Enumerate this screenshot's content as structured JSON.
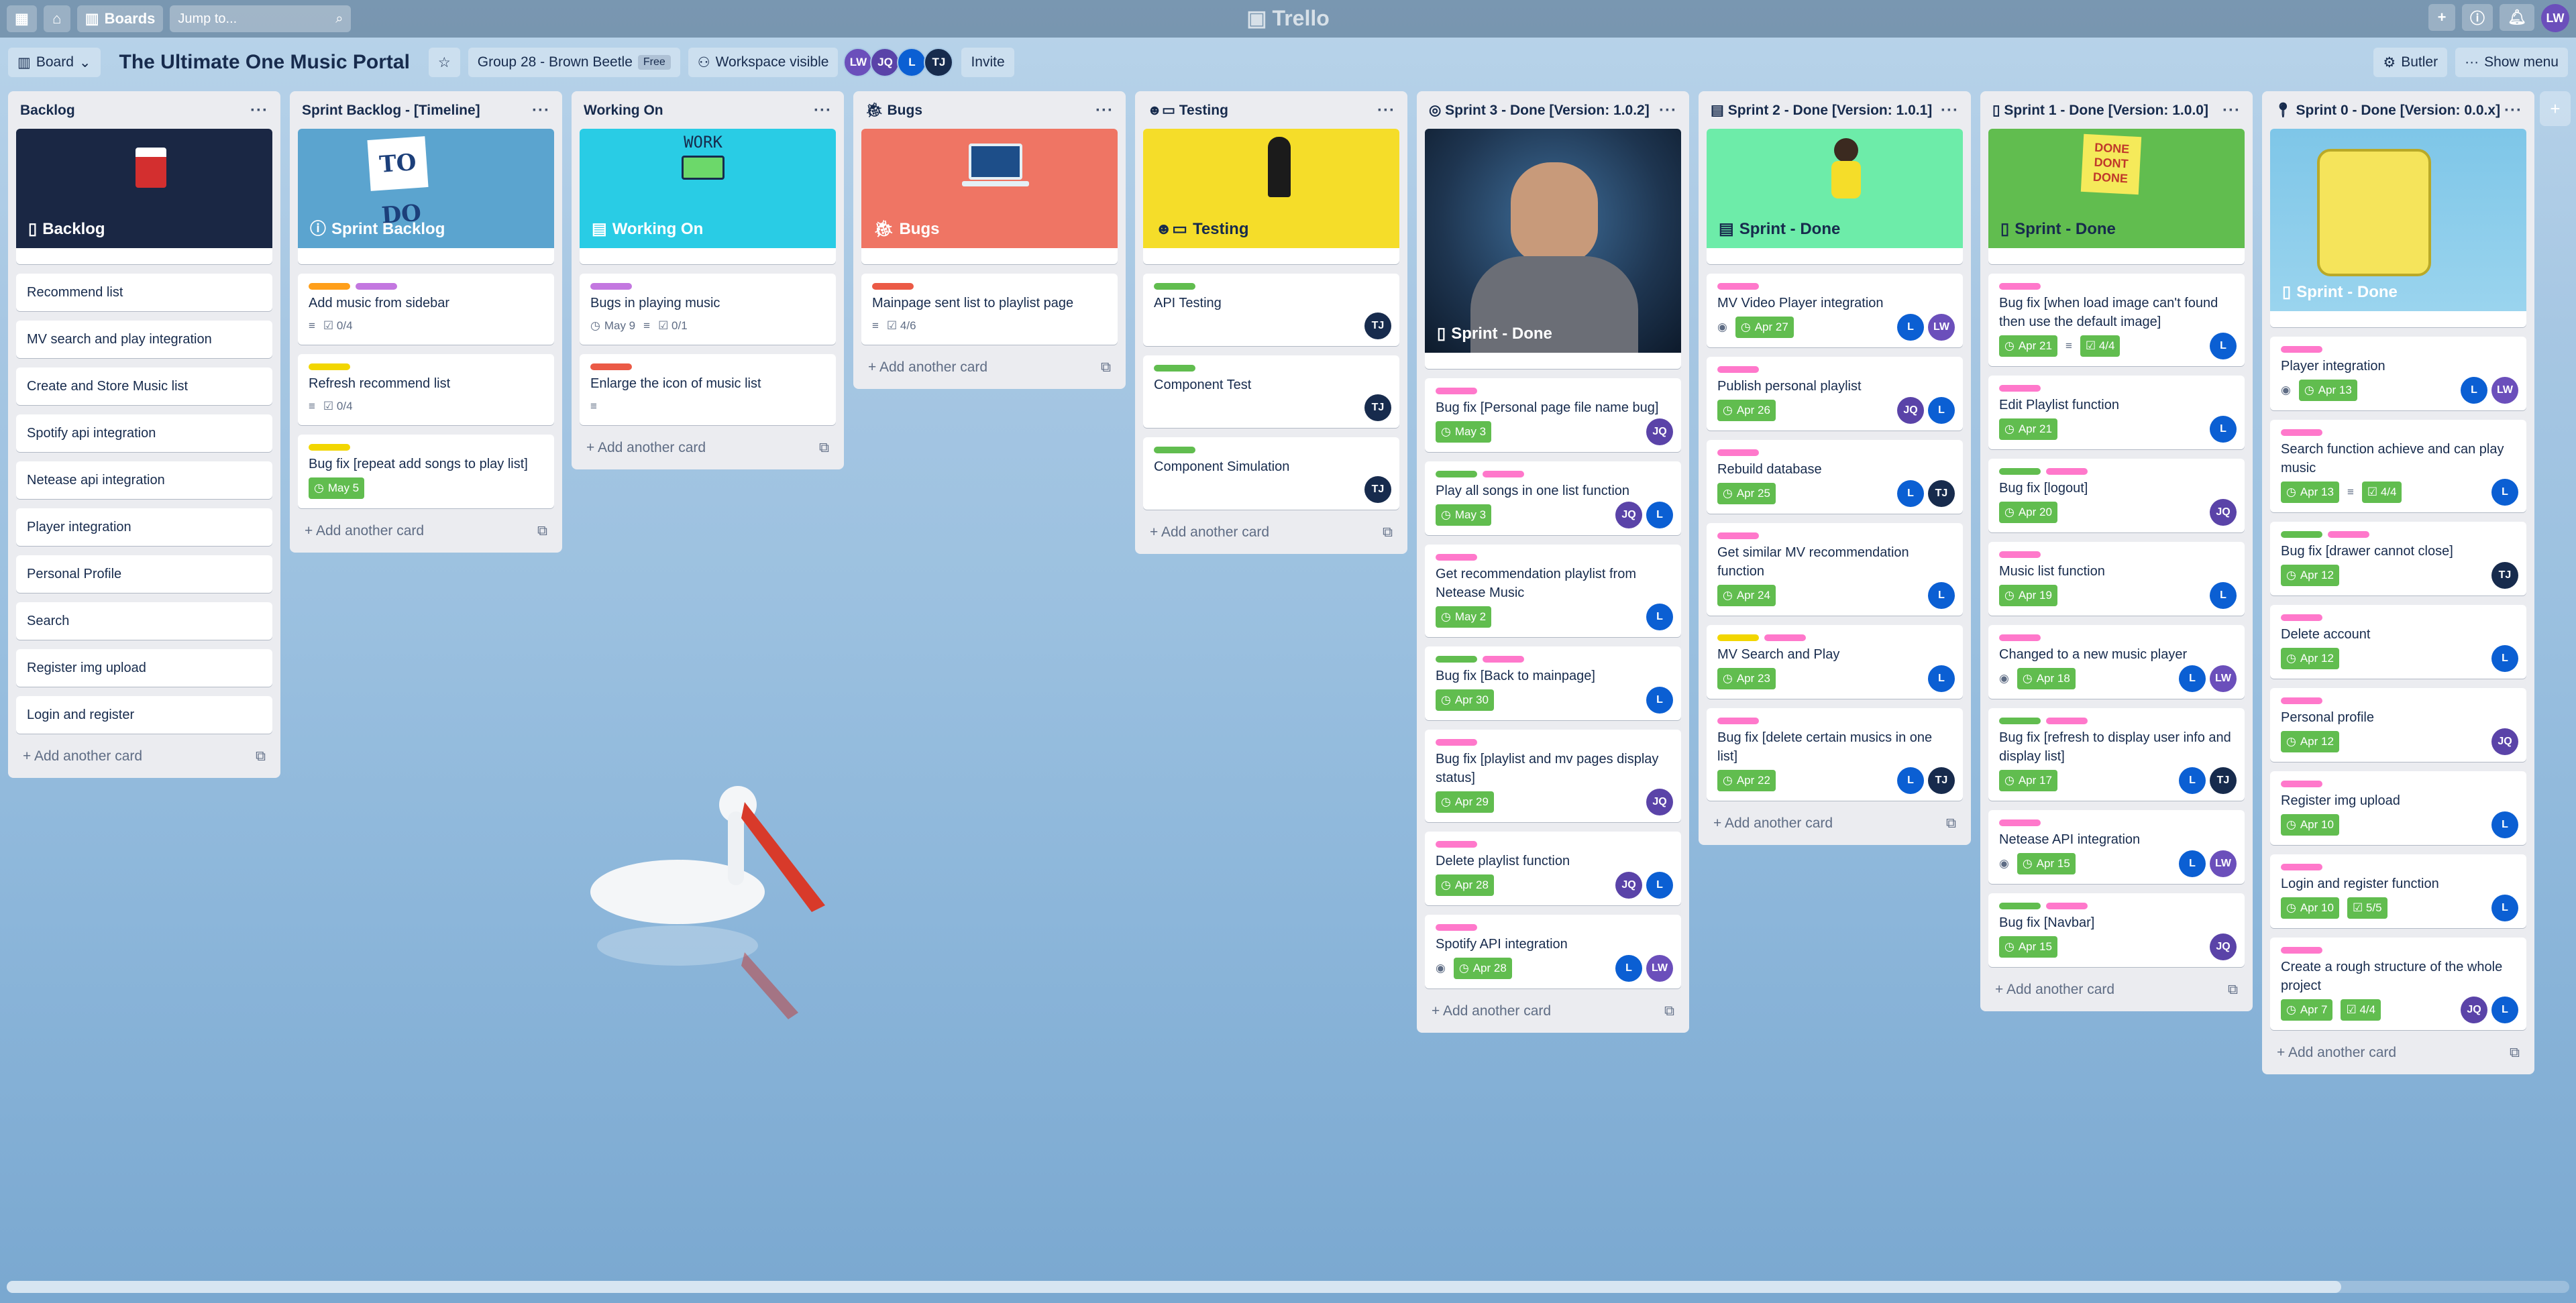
{
  "topbar": {
    "boards_label": "Boards",
    "search_placeholder": "Jump to...",
    "logo_text": "Trello",
    "user_initials": "LW"
  },
  "board": {
    "board_menu_label": "Board",
    "title": "The Ultimate One Music Portal",
    "team_label": "Group 28 - Brown Beetle",
    "team_plan": "Free",
    "visibility_label": "Workspace visible",
    "members": [
      "LW",
      "JQ",
      "L",
      "TJ"
    ],
    "invite_label": "Invite",
    "butler_label": "Butler",
    "show_menu_label": "Show menu"
  },
  "add_card_label": "+ Add another card",
  "lists": [
    {
      "title": "Backlog",
      "cover_title": "Backlog",
      "cards": [
        "Recommend list",
        "MV search and play integration",
        "Create and Store Music list",
        "Spotify api integration",
        "Netease api integration",
        "Player integration",
        "Personal Profile",
        "Search",
        "Register img upload",
        "Login and register"
      ]
    },
    {
      "title": "Sprint Backlog - [Timeline]",
      "cover_title": "Sprint Backlog",
      "cards": [
        {
          "title": "Add music from sidebar",
          "check": "0/4"
        },
        {
          "title": "Refresh recommend list",
          "check": "0/4"
        },
        {
          "title": "Bug fix [repeat add songs to play list]",
          "due": "May 5"
        }
      ]
    },
    {
      "title": "Working On",
      "cover_title": "Working On",
      "cover_text": "WORK",
      "cards": [
        {
          "title": "Bugs in playing music",
          "due": "May 9",
          "check": "0/1"
        },
        {
          "title": "Enlarge the icon of music list"
        }
      ]
    },
    {
      "title": "Bugs",
      "cover_title": "Bugs",
      "cards": [
        {
          "title": "Mainpage sent list to playlist page",
          "check": "4/6"
        }
      ]
    },
    {
      "title": "Testing",
      "cover_title": "Testing",
      "cards": [
        {
          "title": "API Testing",
          "avatars": [
            "TJ"
          ]
        },
        {
          "title": "Component Test",
          "avatars": [
            "TJ"
          ]
        },
        {
          "title": "Component Simulation",
          "avatars": [
            "TJ"
          ]
        }
      ]
    },
    {
      "title": "Sprint 3 - Done [Version: 1.0.2]",
      "cover_title": "Sprint - Done",
      "cards": [
        {
          "title": "Bug fix [Personal page file name bug]",
          "due": "May 3",
          "avatars": [
            "JQ"
          ]
        },
        {
          "title": "Play all songs in one list function",
          "due": "May 3",
          "avatars": [
            "JQ",
            "L"
          ]
        },
        {
          "title": "Get recommendation playlist from Netease Music",
          "due": "May 2",
          "avatars": [
            "L"
          ]
        },
        {
          "title": "Bug fix [Back to mainpage]",
          "due": "Apr 30",
          "avatars": [
            "L"
          ]
        },
        {
          "title": "Bug fix [playlist and mv pages display status]",
          "due": "Apr 29",
          "avatars": [
            "JQ"
          ]
        },
        {
          "title": "Delete playlist function",
          "due": "Apr 28",
          "avatars": [
            "JQ",
            "L"
          ]
        },
        {
          "title": "Spotify API integration",
          "due": "Apr 28",
          "avatars": [
            "L",
            "LW"
          ]
        }
      ]
    },
    {
      "title": "Sprint 2 - Done [Version: 1.0.1]",
      "cover_title": "Sprint - Done",
      "cards": [
        {
          "title": "MV Video Player integration",
          "due": "Apr 27",
          "avatars": [
            "L",
            "LW"
          ]
        },
        {
          "title": "Publish personal playlist",
          "due": "Apr 26",
          "avatars": [
            "JQ",
            "L"
          ]
        },
        {
          "title": "Rebuild database",
          "due": "Apr 25",
          "avatars": [
            "L",
            "TJ"
          ]
        },
        {
          "title": "Get similar MV recommendation function",
          "due": "Apr 24",
          "avatars": [
            "L"
          ]
        },
        {
          "title": "MV Search and Play",
          "due": "Apr 23",
          "avatars": [
            "L"
          ]
        },
        {
          "title": "Bug fix [delete certain musics in one list]",
          "due": "Apr 22",
          "avatars": [
            "L",
            "TJ"
          ]
        }
      ]
    },
    {
      "title": "Sprint 1 - Done [Version: 1.0.0]",
      "cover_title": "Sprint - Done",
      "cover_text": "DONE DONT DONE",
      "cards": [
        {
          "title": "Bug fix [when load image can't found then use the default image]",
          "due": "Apr 21",
          "check": "4/4",
          "avatars": [
            "L"
          ]
        },
        {
          "title": "Edit Playlist function",
          "due": "Apr 21",
          "avatars": [
            "L"
          ]
        },
        {
          "title": "Bug fix [logout]",
          "due": "Apr 20",
          "avatars": [
            "JQ"
          ]
        },
        {
          "title": "Music list function",
          "due": "Apr 19",
          "avatars": [
            "L"
          ]
        },
        {
          "title": "Changed to a new music player",
          "due": "Apr 18",
          "avatars": [
            "L",
            "LW"
          ]
        },
        {
          "title": "Bug fix [refresh to display user info and display list]",
          "due": "Apr 17",
          "avatars": [
            "L",
            "TJ"
          ]
        },
        {
          "title": "Netease API integration",
          "due": "Apr 15",
          "avatars": [
            "L",
            "LW"
          ]
        },
        {
          "title": "Bug fix [Navbar]",
          "due": "Apr 15",
          "avatars": [
            "JQ"
          ]
        }
      ]
    },
    {
      "title": "Sprint 0 - Done [Version: 0.0.x]",
      "cover_title": "Sprint - Done",
      "cards": [
        {
          "title": "Player integration",
          "due": "Apr 13",
          "avatars": [
            "L",
            "LW"
          ]
        },
        {
          "title": "Search function achieve and can play music",
          "due": "Apr 13",
          "check": "4/4",
          "avatars": [
            "L"
          ]
        },
        {
          "title": "Bug fix [drawer cannot close]",
          "due": "Apr 12",
          "avatars": [
            "TJ"
          ]
        },
        {
          "title": "Delete account",
          "due": "Apr 12",
          "avatars": [
            "L"
          ]
        },
        {
          "title": "Personal profile",
          "due": "Apr 12",
          "avatars": [
            "JQ"
          ]
        },
        {
          "title": "Register img upload",
          "due": "Apr 10",
          "avatars": [
            "L"
          ]
        },
        {
          "title": "Login and register function",
          "due": "Apr 10",
          "check": "5/5",
          "avatars": [
            "L"
          ]
        },
        {
          "title": "Create a rough structure of the whole project",
          "due": "Apr 7",
          "check": "4/4",
          "avatars": [
            "JQ",
            "L"
          ]
        }
      ]
    }
  ],
  "colors": {
    "label_green": "#61bd4f",
    "label_pink": "#ff78cb",
    "label_yellow": "#f2d600",
    "label_orange": "#ff9f1a",
    "label_purple": "#c377e0",
    "label_red": "#eb5a46"
  }
}
